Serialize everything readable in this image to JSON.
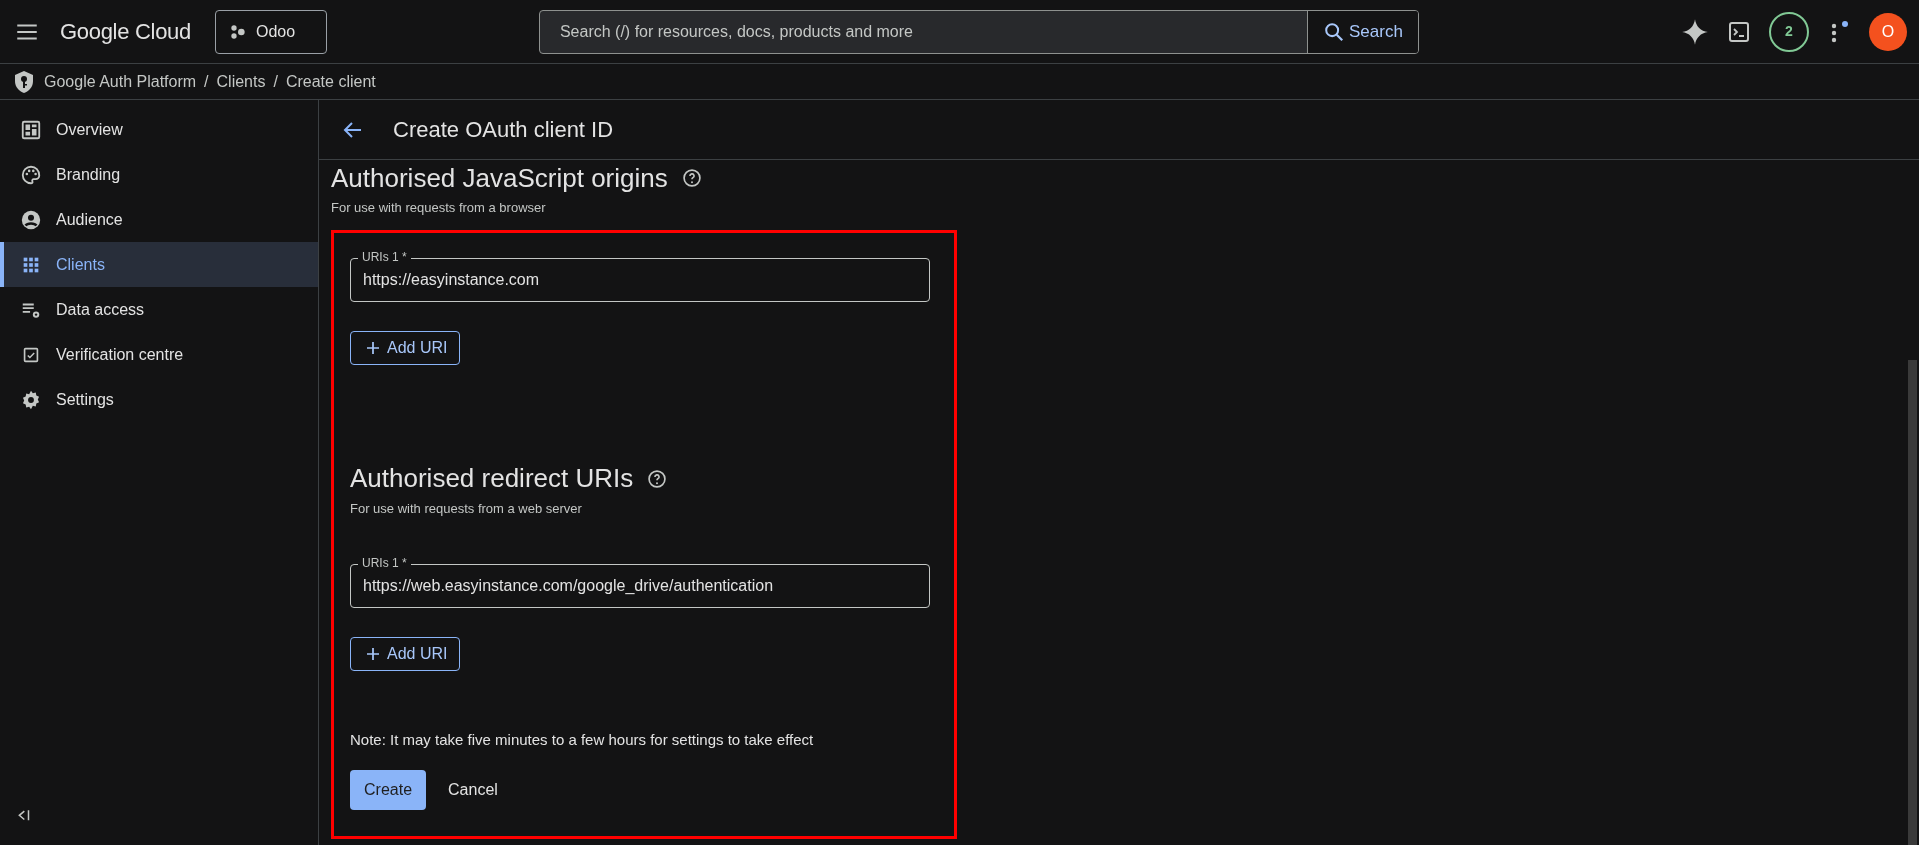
{
  "topbar": {
    "product": "Google Cloud",
    "project": "Odoo",
    "search": {
      "placeholder": "Search (/) for resources, docs, products and more",
      "button": "Search"
    },
    "notifications": "2",
    "avatar": "O"
  },
  "breadcrumb": {
    "items": [
      "Google Auth Platform",
      "Clients",
      "Create client"
    ],
    "separator": "/"
  },
  "sidebar": {
    "items": [
      {
        "label": "Overview",
        "selected": false
      },
      {
        "label": "Branding",
        "selected": false
      },
      {
        "label": "Audience",
        "selected": false
      },
      {
        "label": "Clients",
        "selected": true
      },
      {
        "label": "Data access",
        "selected": false
      },
      {
        "label": "Verification centre",
        "selected": false
      },
      {
        "label": "Settings",
        "selected": false
      }
    ]
  },
  "page": {
    "title": "Create OAuth client ID",
    "sections": [
      {
        "title": "Authorised JavaScript origins",
        "subtitle": "For use with requests from a browser",
        "uris": [
          {
            "label": "URIs 1 *",
            "value": "https://easyinstance.com"
          }
        ],
        "add_button": "Add URI"
      },
      {
        "title": "Authorised redirect URIs",
        "subtitle": "For use with requests from a web server",
        "uris": [
          {
            "label": "URIs 1 *",
            "value": "https://web.easyinstance.com/google_drive/authentication"
          }
        ],
        "add_button": "Add URI"
      }
    ],
    "note": "Note: It may take five minutes to a few hours for settings to take effect",
    "buttons": [
      {
        "label": "Create",
        "kind": "primary"
      },
      {
        "label": "Cancel",
        "kind": "text"
      }
    ],
    "highlight_frame": true
  }
}
